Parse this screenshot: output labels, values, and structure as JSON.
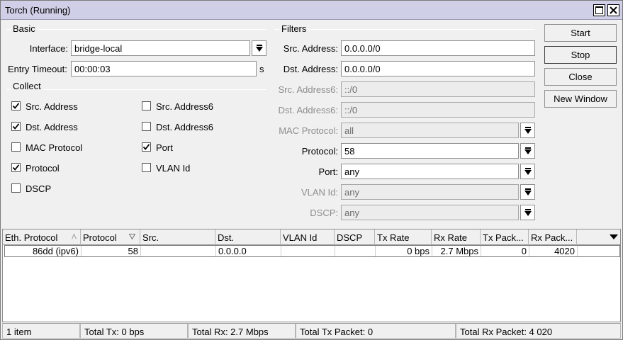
{
  "window": {
    "title": "Torch (Running)"
  },
  "basic": {
    "section_title": "Basic",
    "interface_label": "Interface:",
    "interface_value": "bridge-local",
    "entry_timeout_label": "Entry Timeout:",
    "entry_timeout_value": "00:00:03",
    "entry_timeout_unit": "s"
  },
  "collect": {
    "section_title": "Collect",
    "items": [
      {
        "label": "Src. Address",
        "checked": true
      },
      {
        "label": "Dst. Address",
        "checked": true
      },
      {
        "label": "MAC Protocol",
        "checked": false
      },
      {
        "label": "Protocol",
        "checked": true
      },
      {
        "label": "DSCP",
        "checked": false
      },
      {
        "label": "Src. Address6",
        "checked": false
      },
      {
        "label": "Dst. Address6",
        "checked": false
      },
      {
        "label": "Port",
        "checked": true
      },
      {
        "label": "VLAN Id",
        "checked": false
      }
    ]
  },
  "filters": {
    "section_title": "Filters",
    "src_address_label": "Src. Address:",
    "src_address_value": "0.0.0.0/0",
    "dst_address_label": "Dst. Address:",
    "dst_address_value": "0.0.0.0/0",
    "src_address6_label": "Src. Address6:",
    "src_address6_value": "::/0",
    "dst_address6_label": "Dst. Address6:",
    "dst_address6_value": "::/0",
    "mac_protocol_label": "MAC Protocol:",
    "mac_protocol_value": "all",
    "protocol_label": "Protocol:",
    "protocol_value": "58",
    "port_label": "Port:",
    "port_value": "any",
    "vlan_id_label": "VLAN Id:",
    "vlan_id_value": "any",
    "dscp_label": "DSCP:",
    "dscp_value": "any"
  },
  "buttons": {
    "start": "Start",
    "stop": "Stop",
    "close": "Close",
    "new_window": "New Window"
  },
  "table": {
    "columns": [
      "Eth. Protocol",
      "Protocol",
      "Src.",
      "Dst.",
      "VLAN Id",
      "DSCP",
      "Tx Rate",
      "Rx Rate",
      "Tx Pack...",
      "Rx Pack..."
    ],
    "rows": [
      {
        "eth_protocol": "86dd (ipv6)",
        "protocol": "58",
        "src": "",
        "dst": "0.0.0.0",
        "vlan_id": "",
        "dscp": "",
        "tx_rate": "0 bps",
        "rx_rate": "2.7 Mbps",
        "tx_packets": "0",
        "rx_packets": "4020"
      }
    ]
  },
  "status": {
    "items": "1 item",
    "total_tx": "Total Tx: 0 bps",
    "total_rx": "Total Rx: 2.7 Mbps",
    "total_tx_packet": "Total Tx Packet: 0",
    "total_rx_packet": "Total Rx Packet: 4 020"
  },
  "icons": {
    "dropdown": "dropdown-arrow-icon",
    "checkmark": "checkmark-icon",
    "sort": "sort-triangle-icon",
    "column_menu": "column-menu-icon"
  }
}
